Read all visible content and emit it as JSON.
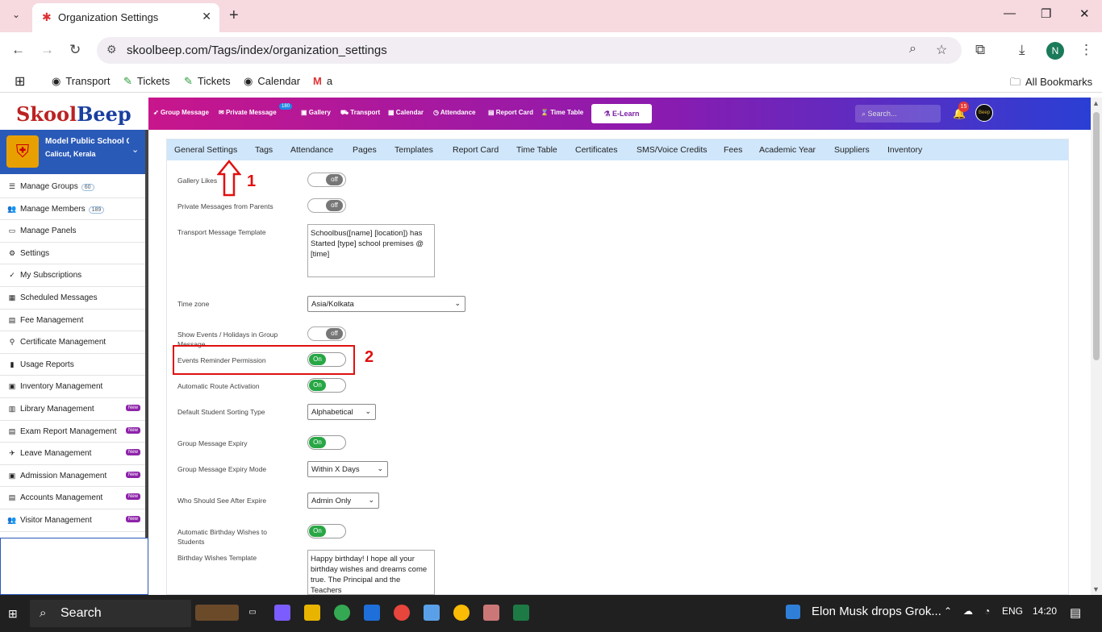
{
  "browser": {
    "tab_title": "Organization Settings",
    "url": "skoolbeep.com/Tags/index/organization_settings",
    "profile_initial": "N",
    "bookmarks": [
      "Transport",
      "Tickets",
      "Tickets",
      "Calendar",
      "a"
    ],
    "all_bookmarks": "All Bookmarks"
  },
  "app": {
    "logo_a": "Skool",
    "logo_b": "Beep",
    "topnav": [
      "Group Message",
      "Private Message",
      "Gallery",
      "Transport",
      "Calendar",
      "Attendance",
      "Report Card",
      "Time Table"
    ],
    "private_badge": "180",
    "elearn": "E-Learn",
    "search_placeholder": "Search...",
    "notifications": "15",
    "avatar_text": "Beep"
  },
  "school": {
    "name": "Model Public School C",
    "location": "Calicut, Kerala"
  },
  "sidebar": [
    {
      "label": "Manage Groups",
      "count": "60",
      "icon": "list-icon"
    },
    {
      "label": "Manage Members",
      "count": "189",
      "icon": "users-icon"
    },
    {
      "label": "Manage Panels",
      "icon": "monitor-icon"
    },
    {
      "label": "Settings",
      "icon": "gear-icon"
    },
    {
      "label": "My Subscriptions",
      "icon": "check-icon"
    },
    {
      "label": "Scheduled Messages",
      "icon": "calendar-icon"
    },
    {
      "label": "Fee Management",
      "icon": "file-icon"
    },
    {
      "label": "Certificate Management",
      "icon": "certificate-icon"
    },
    {
      "label": "Usage Reports",
      "icon": "bar-chart-icon"
    },
    {
      "label": "Inventory Management",
      "icon": "inventory-icon"
    },
    {
      "label": "Library Management",
      "new": "New",
      "icon": "book-icon"
    },
    {
      "label": "Exam Report Management",
      "new": "New",
      "icon": "report-icon"
    },
    {
      "label": "Leave Management",
      "new": "New",
      "icon": "leave-icon"
    },
    {
      "label": "Admission Management",
      "new": "New",
      "icon": "admission-icon"
    },
    {
      "label": "Accounts Management",
      "new": "New",
      "icon": "accounts-icon"
    },
    {
      "label": "Visitor Management",
      "new": "New",
      "icon": "visitor-icon"
    }
  ],
  "tabs": [
    "General Settings",
    "Tags",
    "Attendance",
    "Pages",
    "Templates",
    "Report Card",
    "Time Table",
    "Certificates",
    "SMS/Voice Credits",
    "Fees",
    "Academic Year",
    "Suppliers",
    "Inventory"
  ],
  "settings": {
    "gallery_likes": {
      "label": "Gallery Likes",
      "state": "off"
    },
    "private_messages": {
      "label": "Private Messages from Parents",
      "state": "off"
    },
    "transport_template": {
      "label": "Transport Message Template",
      "value": "Schoolbus([name] [location]) has Started [type] school premises @ [time]"
    },
    "timezone": {
      "label": "Time zone",
      "value": "Asia/Kolkata"
    },
    "show_events": {
      "label": "Show Events / Holidays in Group Message",
      "state": "off"
    },
    "events_reminder": {
      "label": "Events Reminder Permission",
      "state": "On"
    },
    "auto_route": {
      "label": "Automatic Route Activation",
      "state": "On"
    },
    "sorting_type": {
      "label": "Default Student Sorting Type",
      "value": "Alphabetical"
    },
    "group_expiry": {
      "label": "Group Message Expiry",
      "state": "On"
    },
    "expiry_mode": {
      "label": "Group Message Expiry Mode",
      "value": "Within X Days"
    },
    "who_see": {
      "label": "Who Should See After Expire",
      "value": "Admin Only"
    },
    "birthday_auto": {
      "label": "Automatic Birthday Wishes to Students",
      "state": "On"
    },
    "birthday_template": {
      "label": "Birthday Wishes Template",
      "value": "Happy birthday! I hope all your birthday wishes and dreams come true. The Principal and the Teachers"
    }
  },
  "annotations": {
    "a1": "1",
    "a2": "2",
    "annotation_color": "#e01010"
  },
  "taskbar": {
    "search": "Search",
    "news": "Elon Musk drops Grok...",
    "lang": "ENG",
    "time": "14:20"
  }
}
